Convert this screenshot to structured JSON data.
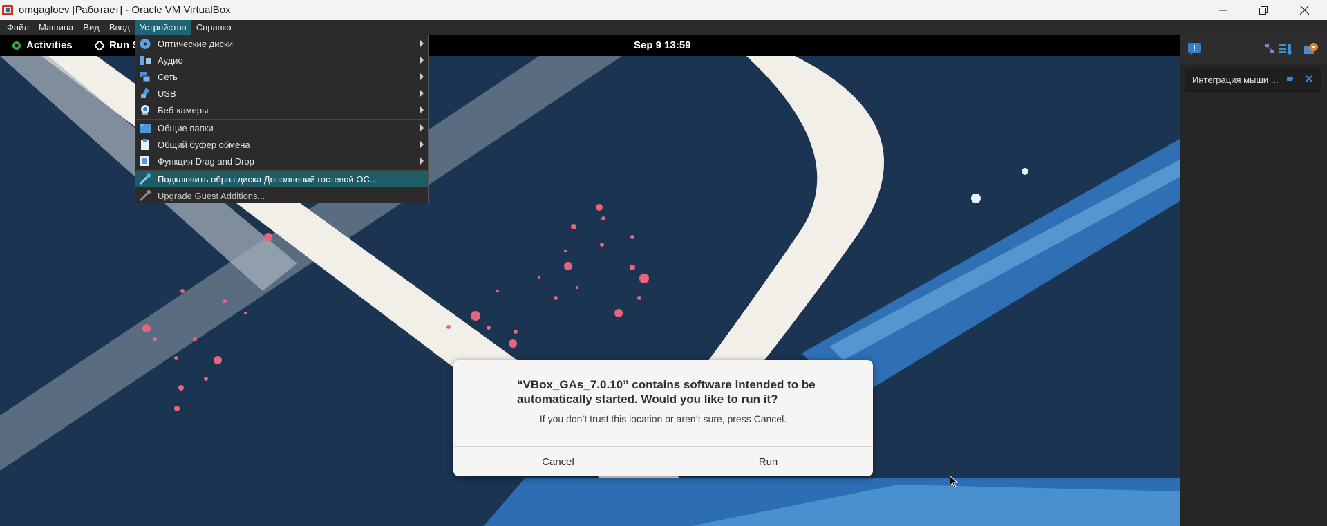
{
  "window": {
    "title": "omgagloev [Работает] - Oracle VM VirtualBox",
    "controls": [
      "minimize-icon",
      "restore-icon",
      "close-icon"
    ]
  },
  "menubar": {
    "items": [
      {
        "label": "Файл"
      },
      {
        "label": "Машина"
      },
      {
        "label": "Вид"
      },
      {
        "label": "Ввод"
      },
      {
        "label": "Устройства",
        "active": true
      },
      {
        "label": "Справка"
      }
    ]
  },
  "devices_menu": {
    "items": [
      {
        "label": "Оптические диски",
        "icon": "optical-disc-icon",
        "submenu": true
      },
      {
        "label": "Аудио",
        "icon": "audio-icon",
        "submenu": true
      },
      {
        "label": "Сеть",
        "icon": "network-icon",
        "submenu": true
      },
      {
        "label": "USB",
        "icon": "usb-icon",
        "submenu": true
      },
      {
        "label": "Веб-камеры",
        "icon": "webcam-icon",
        "submenu": true
      },
      {
        "label": "Общие папки",
        "icon": "shared-folder-icon",
        "submenu": true
      },
      {
        "label": "Общий буфер обмена",
        "icon": "clipboard-icon",
        "submenu": true
      },
      {
        "label": "Функция Drag and Drop",
        "icon": "drag-drop-icon",
        "submenu": true
      },
      {
        "label": "Подключить образ диска Дополнений гостевой ОС...",
        "icon": "guest-additions-icon",
        "highlighted": true
      },
      {
        "label": "Upgrade Guest Additions...",
        "icon": "upgrade-icon",
        "disabled": true
      }
    ]
  },
  "guest_topbar": {
    "activities": "Activities",
    "run": "Run S",
    "clock": "Sep 9  13:59"
  },
  "dialog": {
    "heading": "“VBox_GAs_7.0.10” contains software intended to be automatically started. Would you like to run it?",
    "body": "If you don’t trust this location or aren’t sure, press Cancel.",
    "cancel": "Cancel",
    "run": "Run"
  },
  "side_panel": {
    "notification": "Интеграция мыши ...",
    "icons": [
      "message-icon",
      "network-activity-icon",
      "storage-activity-icon",
      "vm-settings-icon"
    ]
  },
  "colors": {
    "menu_active": "#1e6676",
    "wallpaper_bg": "#1b3452",
    "dialog_bg": "#f6f5f4"
  }
}
